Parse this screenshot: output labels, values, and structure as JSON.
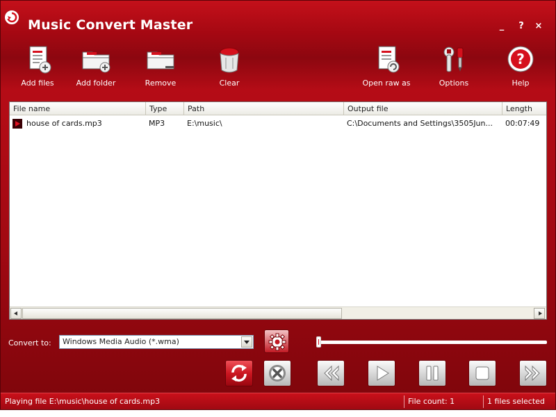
{
  "window": {
    "title": "Music Convert Master",
    "controls": {
      "minimize": "_",
      "help": "?",
      "close": "×"
    }
  },
  "toolbar": {
    "items": [
      {
        "label": "Add files",
        "icon": "add-files-icon"
      },
      {
        "label": "Add folder",
        "icon": "add-folder-icon"
      },
      {
        "label": "Remove",
        "icon": "remove-icon"
      },
      {
        "label": "Clear",
        "icon": "clear-icon"
      },
      {
        "label": "Open raw as",
        "icon": "open-raw-icon"
      },
      {
        "label": "Options",
        "icon": "options-icon"
      },
      {
        "label": "Help",
        "icon": "help-icon"
      }
    ]
  },
  "filelist": {
    "columns": [
      "File name",
      "Type",
      "Path",
      "Output file",
      "Length"
    ],
    "rows": [
      {
        "name": "house of cards.mp3",
        "type": "MP3",
        "path": "E:\\music\\",
        "output": "C:\\Documents and Settings\\3505Jun...",
        "length": "00:07:49"
      }
    ]
  },
  "convert": {
    "label": "Convert to:",
    "format": "Windows Media Audio (*.wma)"
  },
  "playback": {
    "position": 0.0
  },
  "status": {
    "playing": "Playing file E:\\music\\house of cards.mp3",
    "file_count": "File count: 1",
    "selected": "1 files selected"
  },
  "colors": {
    "accent": "#c4101a",
    "dark_accent": "#7d050b",
    "text": "#ffffff"
  }
}
